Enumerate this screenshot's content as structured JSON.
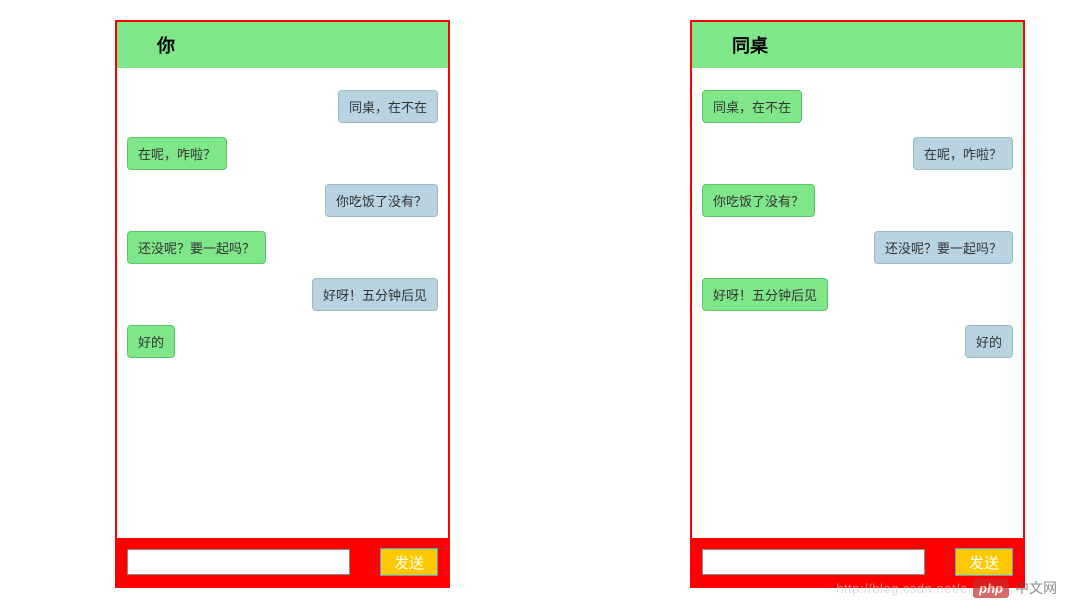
{
  "left_panel": {
    "title": "你",
    "messages": [
      {
        "side": "right",
        "color": "blue",
        "text": "同桌，在不在"
      },
      {
        "side": "left",
        "color": "green",
        "text": "在呢，咋啦？"
      },
      {
        "side": "right",
        "color": "blue",
        "text": "你吃饭了没有？"
      },
      {
        "side": "left",
        "color": "green",
        "text": "还没呢？要一起吗？"
      },
      {
        "side": "right",
        "color": "blue",
        "text": "好呀！五分钟后见"
      },
      {
        "side": "left",
        "color": "green",
        "text": "好的"
      }
    ],
    "input_value": "",
    "send_label": "发送"
  },
  "right_panel": {
    "title": "同桌",
    "messages": [
      {
        "side": "left",
        "color": "green",
        "text": "同桌，在不在"
      },
      {
        "side": "right",
        "color": "blue",
        "text": "在呢，咋啦？"
      },
      {
        "side": "left",
        "color": "green",
        "text": "你吃饭了没有？"
      },
      {
        "side": "right",
        "color": "blue",
        "text": "还没呢？要一起吗？"
      },
      {
        "side": "left",
        "color": "green",
        "text": "好呀！五分钟后见"
      },
      {
        "side": "right",
        "color": "blue",
        "text": "好的"
      }
    ],
    "input_value": "",
    "send_label": "发送"
  },
  "watermark": {
    "url": "http://blog.csdn.net/c",
    "logo": "php",
    "cn": "中文网"
  }
}
